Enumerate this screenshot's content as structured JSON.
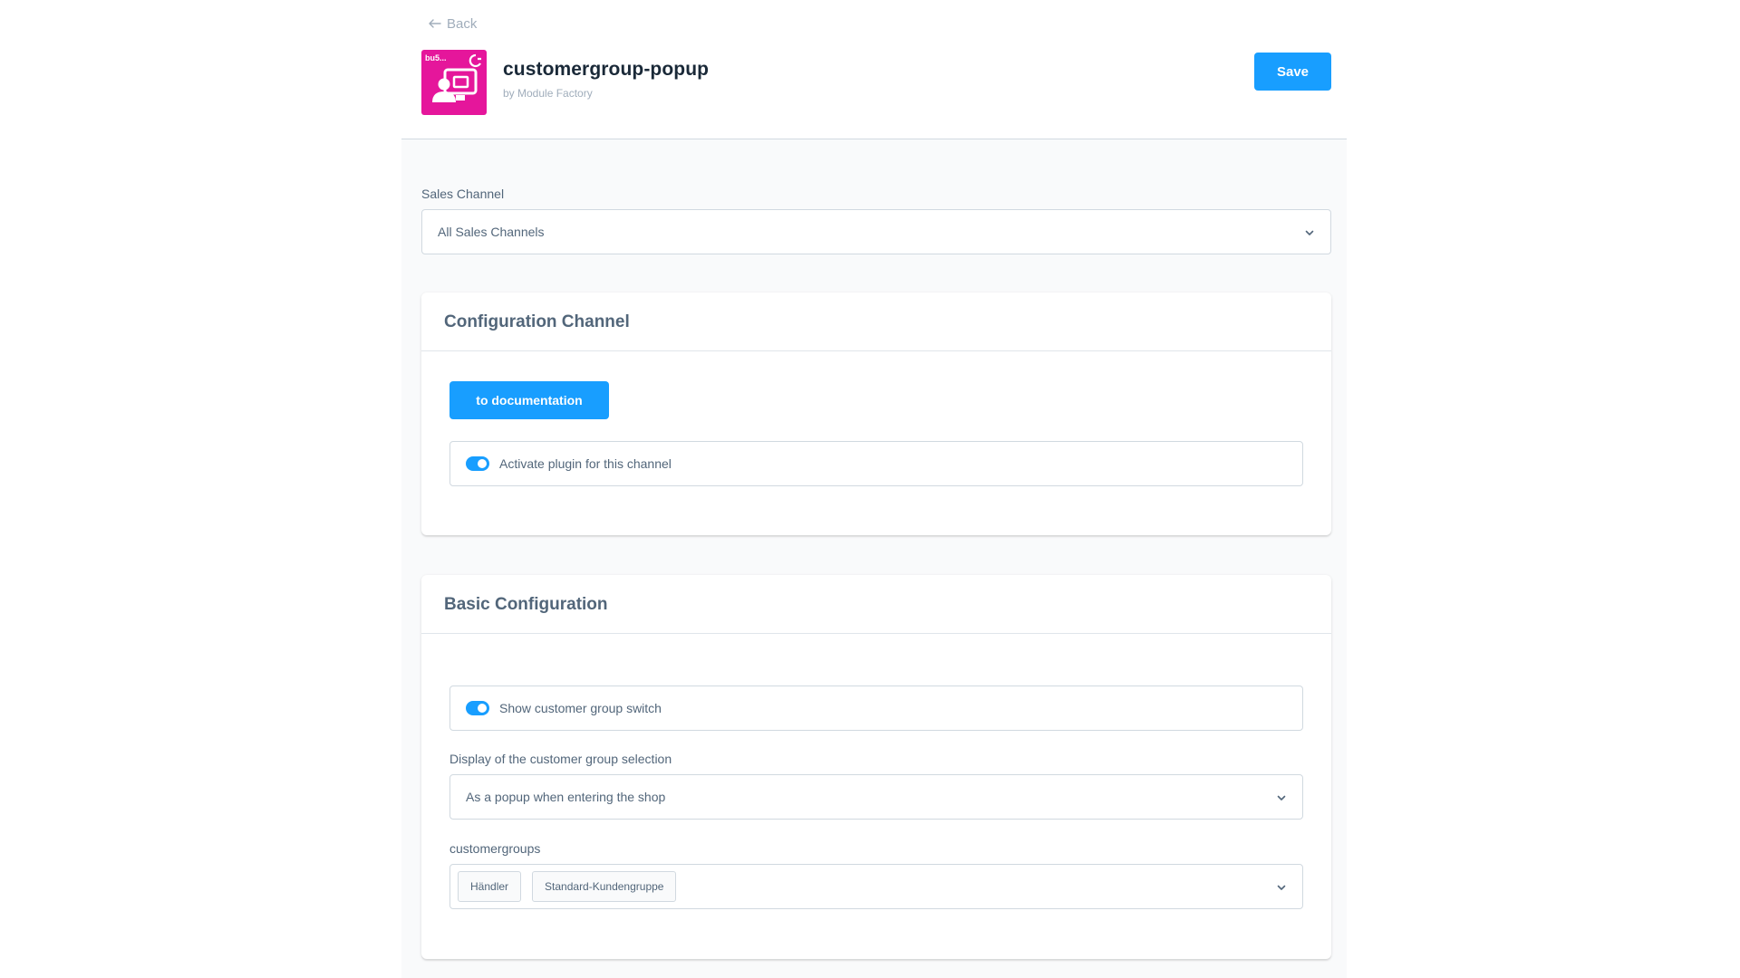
{
  "header": {
    "back_label": "Back",
    "app_title": "customergroup-popup",
    "app_subtitle": "by Module Factory",
    "save_label": "Save",
    "logo_text": "bu5..."
  },
  "sales_channel": {
    "label": "Sales Channel",
    "value": "All Sales Channels"
  },
  "config_channel": {
    "title": "Configuration Channel",
    "doc_button_label": "to documentation",
    "activate_label": "Activate plugin for this channel",
    "activate_on": true
  },
  "basic_config": {
    "title": "Basic Configuration",
    "show_switch_label": "Show customer group switch",
    "show_switch_on": true,
    "display_label": "Display of the customer group selection",
    "display_value": "As a popup when entering the shop",
    "groups_label": "customergroups",
    "groups": [
      "Händler",
      "Standard-Kundengruppe"
    ]
  },
  "colors": {
    "accent": "#189eff",
    "logo_bg": "#e5169b",
    "text": "#52667a",
    "title": "#1a2938"
  },
  "icons": {
    "back": "arrow-left-icon",
    "chevron": "chevron-down-icon",
    "logo": "customer-group-popup-logo"
  }
}
